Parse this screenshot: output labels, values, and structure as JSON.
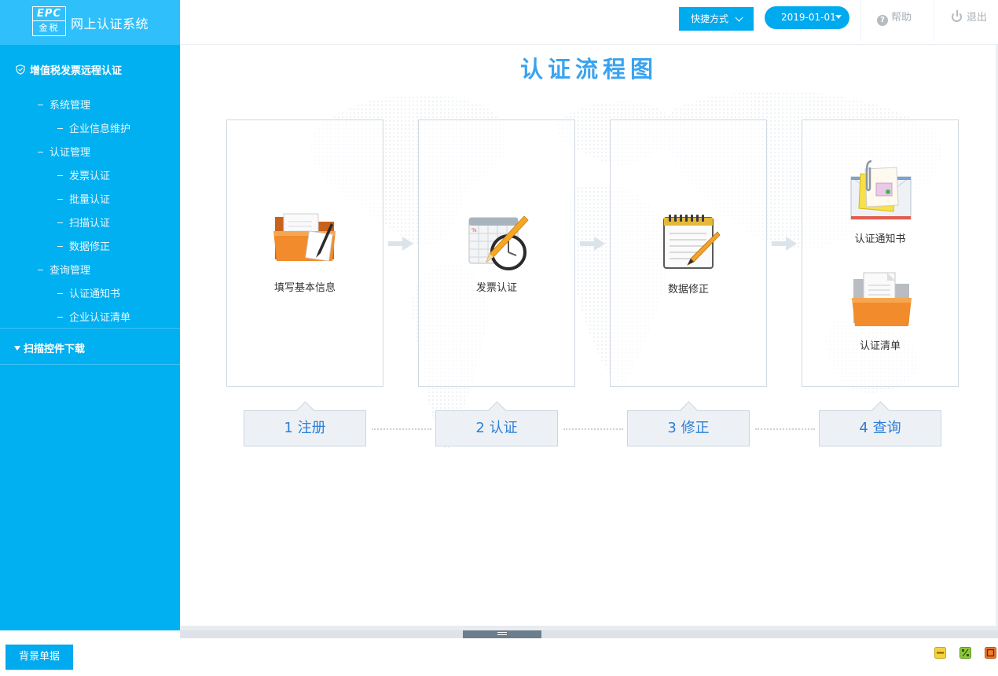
{
  "brand": {
    "logo_text": "EPC",
    "logo_sub": "金税",
    "app_title": "网上认证系统"
  },
  "header": {
    "quick_label": "快捷方式",
    "date_value": "2019-01-01",
    "help_label": "帮助",
    "logout_label": "退出"
  },
  "sidebar": {
    "group_title": "增值税发票远程认证",
    "items": [
      {
        "label": "系统管理",
        "level": 1
      },
      {
        "label": "企业信息维护",
        "level": 2
      },
      {
        "label": "认证管理",
        "level": 1
      },
      {
        "label": "发票认证",
        "level": 2
      },
      {
        "label": "批量认证",
        "level": 2
      },
      {
        "label": "扫描认证",
        "level": 2
      },
      {
        "label": "数据修正",
        "level": 2
      },
      {
        "label": "查询管理",
        "level": 1
      },
      {
        "label": "认证通知书",
        "level": 2
      },
      {
        "label": "企业认证清单",
        "level": 2
      }
    ],
    "download_label": "扫描控件下载"
  },
  "main": {
    "title": "认证流程图",
    "cards": [
      {
        "label": "填写基本信息"
      },
      {
        "label": "发票认证"
      },
      {
        "label": "数据修正"
      },
      {
        "label_top": "认证通知书",
        "label_bottom": "认证清单"
      }
    ],
    "steps": [
      {
        "label": "1 注册"
      },
      {
        "label": "2 认证"
      },
      {
        "label": "3 修正"
      },
      {
        "label": "4 查询"
      }
    ]
  },
  "footer": {
    "bg_button_label": "背景单据"
  },
  "colors": {
    "accent": "#00b0f0",
    "brand": "#2fc0fb",
    "step_text": "#2c7fd6",
    "title": "#3aa3f0"
  }
}
